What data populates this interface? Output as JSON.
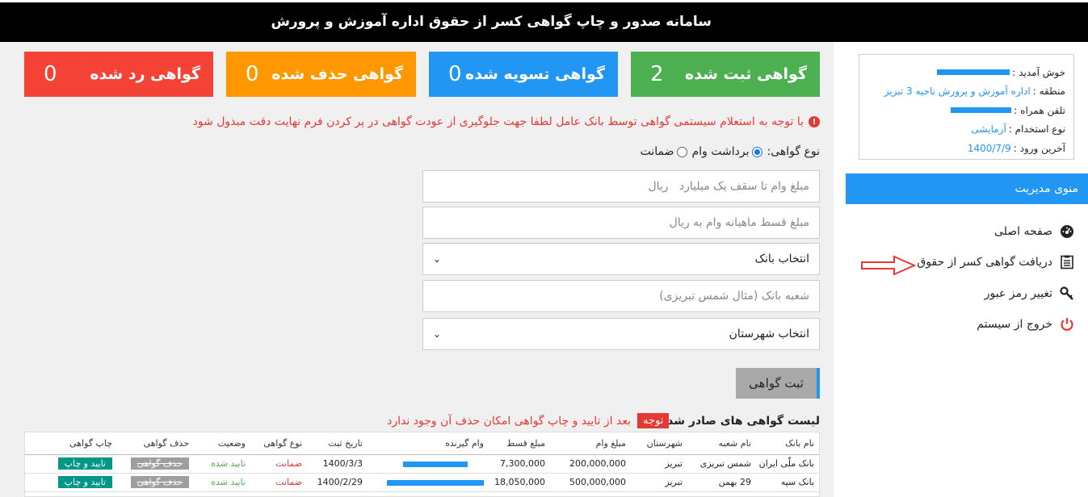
{
  "header": {
    "title": "سامانه صدور و چاپ گواهی کسر از حقوق اداره آموزش و پرورش"
  },
  "stats": [
    {
      "label": "گواهی ثبت شده",
      "value": "2",
      "color": "#4caf50"
    },
    {
      "label": "گواهی تسویه شده",
      "value": "0",
      "color": "#2196f3"
    },
    {
      "label": "گواهی حذف شده",
      "value": "0",
      "color": "#ff9800"
    },
    {
      "label": "گواهی رد شده",
      "value": "0",
      "color": "#f44336"
    }
  ],
  "warning": "با توجه به استعلام سیستمی گواهی توسط بانک عامل لطفا جهت جلوگیری از عودت گواهی در پر کردن فرم نهایت دقت مبذول شود",
  "form": {
    "type_label": "نوع گواهی:",
    "type_options": [
      "برداشت وام",
      "ضمانت"
    ],
    "type_selected": "برداشت وام",
    "loan_amount_placeholder": "مبلغ وام تا سقف یک میلیارد   ریال",
    "installment_placeholder": "مبلغ قسط ماهیانه وام به ریال",
    "bank_select": "انتخاب بانک",
    "branch_placeholder": "شعبه بانک (مثال شمس تبریزی)",
    "city_select": "انتخاب شهرستان",
    "submit_label": "ثبت گواهی"
  },
  "list": {
    "title": "لیست گواهی های صادر شده",
    "note_badge": "توجه",
    "note_text": "بعد از تایید و چاپ گواهی امکان حذف آن وجود ندارد",
    "columns": [
      "نام بانک",
      "نام شعبه",
      "شهرستان",
      "مبلغ وام",
      "مبلغ قسط",
      "وام گیرنده",
      "تاریخ ثبت",
      "نوع گواهی",
      "وضعیت",
      "حذف گواهی",
      "چاپ گواهی"
    ],
    "rows": [
      {
        "bank": "بانک ملّی ایران",
        "branch": "شمس تبریزی",
        "city": "تبریز",
        "loan": "200,000,000",
        "installment": "7,300,000",
        "borrower": "",
        "date": "1400/3/3",
        "type": "ضمانت",
        "status": "تایید شده",
        "delete": "حذف گواهی",
        "print": "تایید و چاپ"
      },
      {
        "bank": "بانک سپه",
        "branch": "29 بهمن",
        "city": "تبریز",
        "loan": "500,000,000",
        "installment": "18,050,000",
        "borrower": "",
        "date": "1400/2/29",
        "type": "ضمانت",
        "status": "تایید شده",
        "delete": "حذف گواهی",
        "print": "تایید و چاپ"
      }
    ]
  },
  "user": {
    "welcome_label": "خوش آمدید :",
    "region_label": "منطقه :",
    "region_value": "اداره آموزش و پرورش ناحیه 3 تبریز",
    "phone_label": "تلفن همراه :",
    "employment_label": "نوع استخدام :",
    "employment_value": "آزمایشی",
    "last_login_label": "آخرین ورود :",
    "last_login_value": "1400/7/9"
  },
  "menu": {
    "title": "منوی مدیریت",
    "items": [
      "صفحه اصلی",
      "دریافت گواهی کسر از حقوق",
      "تغییر رمز عبور",
      "خروج از سیستم"
    ]
  },
  "icons": {
    "warning": "exclamation-circle-icon",
    "home": "dashboard-gauge-icon",
    "certificate": "list-document-icon",
    "password": "key-icon",
    "logout": "power-icon",
    "pointer": "arrow-right-icon"
  },
  "colors": {
    "accent": "#2196f3",
    "danger": "#e53935",
    "success": "#4caf50",
    "print": "#009688"
  }
}
